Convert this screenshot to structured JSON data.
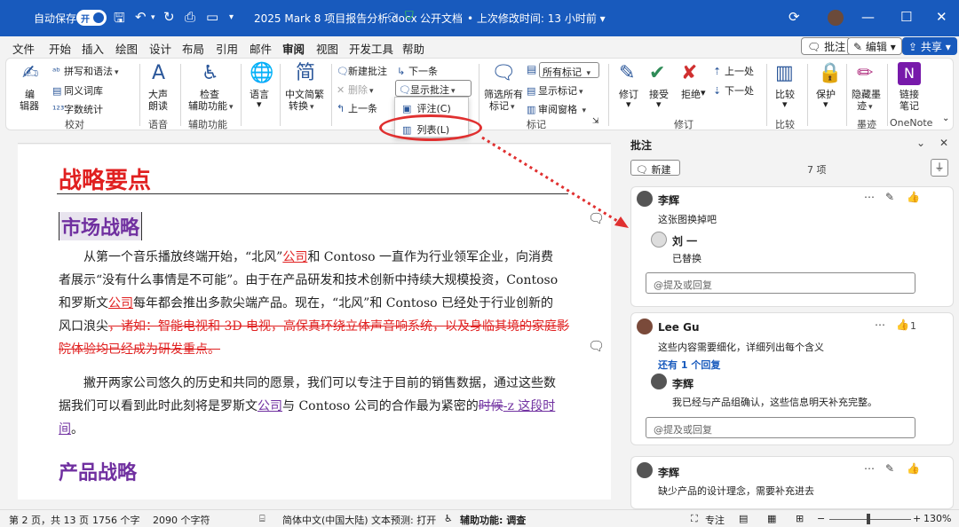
{
  "titlebar": {
    "autosave": "自动保存",
    "toggle": "开",
    "filename": "2025 Mark 8 项目报告分析.docx",
    "public": "公开文档",
    "modified": "上次修改时间: 13 小时前"
  },
  "menu": {
    "tabs": [
      "文件",
      "开始",
      "插入",
      "绘图",
      "设计",
      "布局",
      "引用",
      "邮件",
      "审阅",
      "视图",
      "开发工具",
      "帮助"
    ],
    "comment": "批注",
    "edit": "编辑",
    "share": "共享"
  },
  "ribbon": {
    "spell": "拼写和语法",
    "thesaurus": "同义词库",
    "wordcount": "字数统计",
    "editor": [
      "编",
      "辑器"
    ],
    "g_proof": "校对",
    "readaloud": [
      "大声",
      "朗读"
    ],
    "g_speech": "语音",
    "accessibility": [
      "检查",
      "辅助功能"
    ],
    "g_access": "辅助功能",
    "language": "语言",
    "convert": [
      "中文简繁",
      "转换"
    ],
    "newcomment": "新建批注",
    "delete": "删除",
    "previous": "上一条",
    "next": "下一条",
    "showcomments": "显示批注",
    "popup_comment": "评注(C)",
    "popup_list": "列表(L)",
    "filter": [
      "筛选所有",
      "标记"
    ],
    "allmarkup": "所有标记",
    "showmarkup": "显示标记",
    "reviewpane": "审阅窗格",
    "g_markup": "标记",
    "track": "修订",
    "accept": "接受",
    "reject": "拒绝",
    "prev": "上一处",
    "nextc": "下一处",
    "g_changes": "修订",
    "compare": "比较",
    "g_compare": "比较",
    "protect": "保护",
    "ink": [
      "隐藏墨",
      "迹"
    ],
    "g_ink": "墨迹",
    "linked": [
      "链接",
      "笔记"
    ],
    "g_onenote": "OneNote"
  },
  "doc": {
    "h1": "战略要点",
    "h2a": "市场战略",
    "p1": [
      [
        "从第一个音乐播放终端开始，“北风”",
        "公司",
        "和 Contoso 一直作为行业领军企业，向消费"
      ],
      [
        "者展示“没有什么事情是不可能”。由于在产品研发和技术创新中持续大规模投资，Contoso"
      ],
      [
        "和罗斯文",
        "公司",
        "每年都会推出多款尖端产品。现在，“北风”和 Contoso 已经处于行业创新的"
      ],
      [
        "风口浪尖",
        "，诸如：智能电视和 3D 电视，高保真环绕立体声音响系统，以及身临其境的家庭影"
      ],
      [
        "院体验均已经成为研发重点。"
      ]
    ],
    "p2": [
      [
        "撇开两家公司悠久的历史和共同的愿景，我们可以专注于目前的销售数据，通过这些数"
      ],
      [
        "据我们可以看到此时此刻将是罗斯文",
        "公司",
        "与 Contoso 公司的合作最为紧密的",
        "时候",
        "-z 这段时"
      ],
      [
        "间",
        "。"
      ]
    ],
    "h2b": "产品战略"
  },
  "pane": {
    "title": "批注",
    "new": "新建",
    "count": "7 项",
    "c1": {
      "author": "李辉",
      "text": "这张图换掉吧",
      "reply_author": "刘 一",
      "reply_text": "已替换",
      "placeholder": "@提及或回复"
    },
    "c2": {
      "author": "Lee Gu",
      "text": "这些内容需要细化，详细列出每个含义",
      "likes": "1",
      "more": "还有 1 个回复",
      "reply_author": "李辉",
      "reply_text": "我已经与产品组确认，这些信息明天补充完整。",
      "placeholder": "@提及或回复"
    },
    "c3": {
      "author": "李辉",
      "text": "缺少产品的设计理念，需要补充进去"
    }
  },
  "status": {
    "page": "第 2 页，共 13 页",
    "words": "1756 个字",
    "chars": "2090 个字符",
    "lang": "简体中文(中国大陆)",
    "predict": "文本预测: 打开",
    "access": "辅助功能: 调查",
    "focus": "专注",
    "zoom": "130%"
  },
  "colors": {
    "brand": "#185abd",
    "markup": "#e02020",
    "heading": "#7030a0"
  }
}
